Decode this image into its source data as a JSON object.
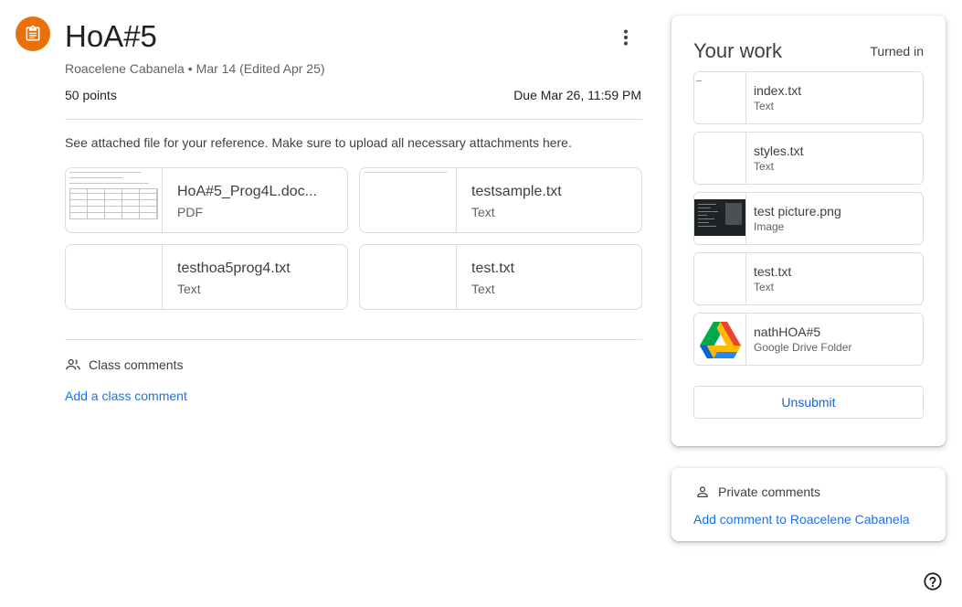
{
  "assignment": {
    "title": "HoA#5",
    "author": "Roacelene Cabanela",
    "date": "Mar 14 (Edited Apr 25)",
    "points": "50 points",
    "due": "Due Mar 26, 11:59 PM",
    "description": "See attached file for your reference. Make sure to upload all necessary attachments here.",
    "icon": "assignment-icon",
    "accent_color": "#e8710a",
    "attachments": [
      {
        "name": "HoA#5_Prog4L.doc...",
        "type": "PDF"
      },
      {
        "name": "testsample.txt",
        "type": "Text"
      },
      {
        "name": "testhoa5prog4.txt",
        "type": "Text"
      },
      {
        "name": "test.txt",
        "type": "Text"
      }
    ]
  },
  "class_comments": {
    "label": "Class comments",
    "add_label": "Add a class comment"
  },
  "your_work": {
    "title": "Your work",
    "status": "Turned in",
    "files": [
      {
        "name": "index.txt",
        "type": "Text"
      },
      {
        "name": "styles.txt",
        "type": "Text"
      },
      {
        "name": "test picture.png",
        "type": "Image"
      },
      {
        "name": "test.txt",
        "type": "Text"
      },
      {
        "name": "nathHOA#5",
        "type": "Google Drive Folder"
      }
    ],
    "unsubmit_label": "Unsubmit"
  },
  "private_comments": {
    "label": "Private comments",
    "add_label": "Add comment to Roacelene Cabanela"
  },
  "colors": {
    "link": "#1a73e8",
    "border": "#dadce0"
  }
}
